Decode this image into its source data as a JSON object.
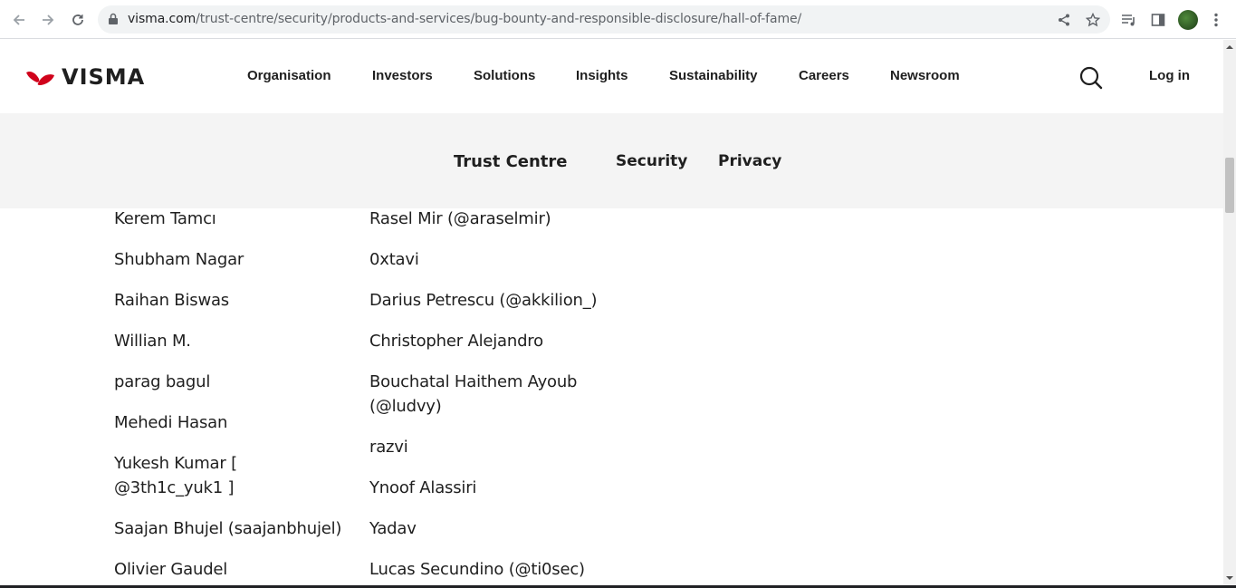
{
  "browser": {
    "url_host": "visma.com",
    "url_path": "/trust-centre/security/products-and-services/bug-bounty-and-responsible-disclosure/hall-of-fame/"
  },
  "header": {
    "logo_text": "VISMA",
    "nav": [
      "Organisation",
      "Investors",
      "Solutions",
      "Insights",
      "Sustainability",
      "Careers",
      "Newsroom"
    ],
    "login_label": "Log in",
    "brand_color": "#d0021b"
  },
  "subnav": {
    "title": "Trust Centre",
    "items": [
      "Security",
      "Privacy"
    ]
  },
  "hall_of_fame": {
    "left_column": [
      "Kerem Tamcı",
      "Shubham Nagar",
      "Raihan Biswas",
      "Willian M.",
      "parag bagul",
      "Mehedi Hasan",
      "Yukesh Kumar [ @3th1c_yuk1 ]",
      "Saajan Bhujel (saajanbhujel)",
      "Olivier Gaudel"
    ],
    "right_column": [
      "Rasel Mir (@araselmir)",
      "0xtavi",
      "Darius Petrescu (@akkilion_)",
      "Christopher Alejandro",
      "Bouchatal Haithem Ayoub (@ludvy)",
      "razvi",
      "Ynoof Alassiri",
      "Yadav",
      "Lucas Secundino (@ti0sec)"
    ]
  }
}
